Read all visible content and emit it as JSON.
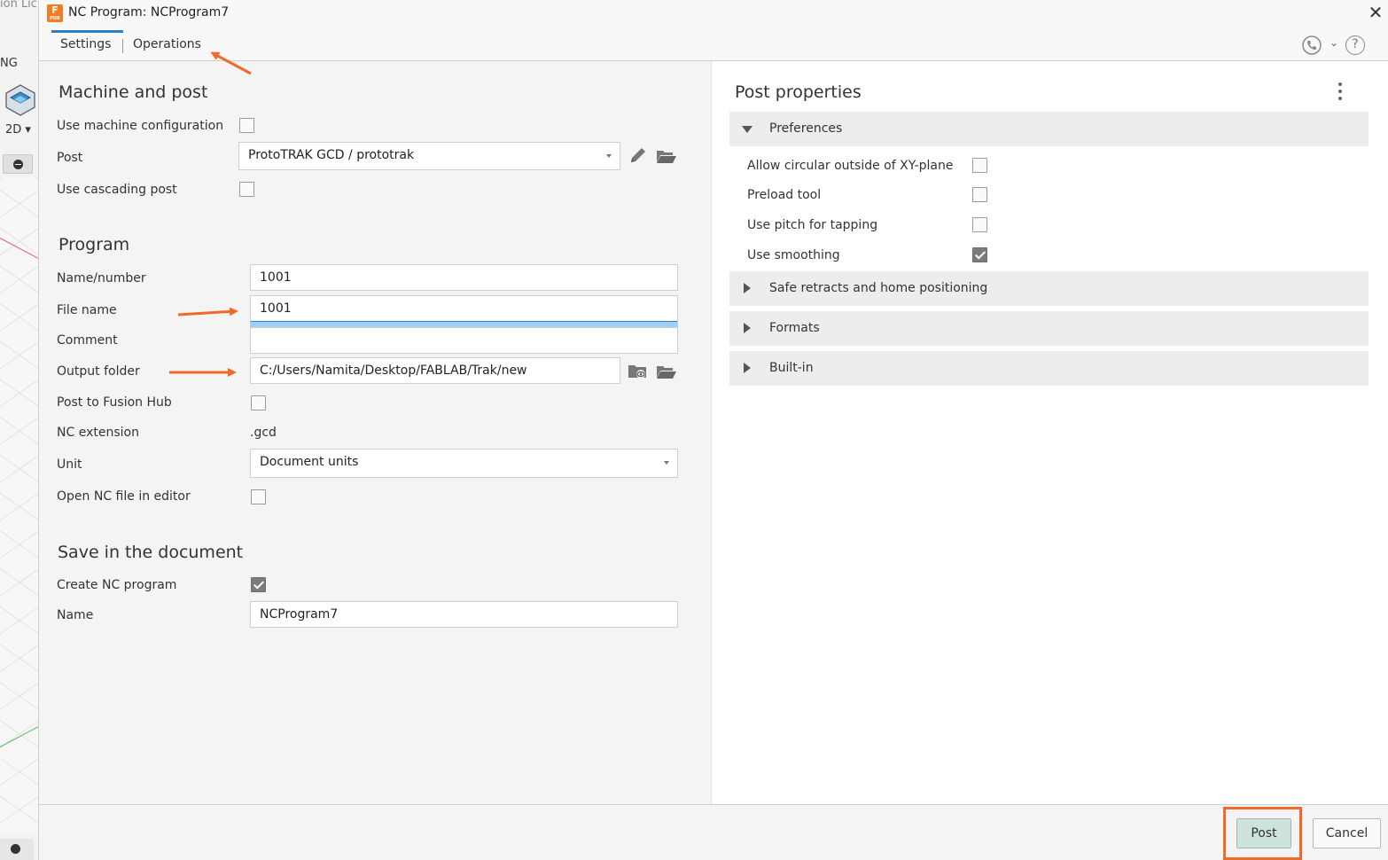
{
  "background_app": {
    "top_text": "ion Lic",
    "side_label": "NG",
    "view_mode": "2D ▾"
  },
  "window": {
    "title": "NC Program: NCProgram7",
    "logo_letter": "F",
    "logo_sub": "PUB"
  },
  "tabs": {
    "settings": "Settings",
    "operations": "Operations"
  },
  "machine_and_post": {
    "title": "Machine and post",
    "use_machine_configuration_label": "Use machine configuration",
    "use_machine_configuration_checked": false,
    "post_label": "Post",
    "post_value": "ProtoTRAK GCD / prototrak",
    "use_cascading_post_label": "Use cascading post",
    "use_cascading_post_checked": false
  },
  "program": {
    "title": "Program",
    "name_number_label": "Name/number",
    "name_number_value": "1001",
    "file_name_label": "File name",
    "file_name_value": "1001",
    "comment_label": "Comment",
    "comment_value": "",
    "output_folder_label": "Output folder",
    "output_folder_value": "C:/Users/Namita/Desktop/FABLAB/Trak/new",
    "post_to_hub_label": "Post to Fusion Hub",
    "post_to_hub_checked": false,
    "nc_extension_label": "NC extension",
    "nc_extension_value": ".gcd",
    "unit_label": "Unit",
    "unit_value": "Document units",
    "open_in_editor_label": "Open NC file in editor",
    "open_in_editor_checked": false
  },
  "save_in_document": {
    "title": "Save in the document",
    "create_nc_program_label": "Create NC program",
    "create_nc_program_checked": true,
    "name_label": "Name",
    "name_value": "NCProgram7"
  },
  "post_properties": {
    "title": "Post properties",
    "groups": {
      "preferences": "Preferences",
      "safe_retracts": "Safe retracts and home positioning",
      "formats": "Formats",
      "built_in": "Built-in"
    },
    "preferences": [
      {
        "label": "Allow circular outside of XY-plane",
        "checked": false
      },
      {
        "label": "Preload tool",
        "checked": false
      },
      {
        "label": "Use pitch for tapping",
        "checked": false
      },
      {
        "label": "Use smoothing",
        "checked": true
      }
    ]
  },
  "footer": {
    "post_button": "Post",
    "cancel_button": "Cancel"
  },
  "colors": {
    "annotation_arrow": "#f06a25",
    "tab_accent": "#2f7fc8",
    "post_button_bg": "#cfe3de"
  }
}
